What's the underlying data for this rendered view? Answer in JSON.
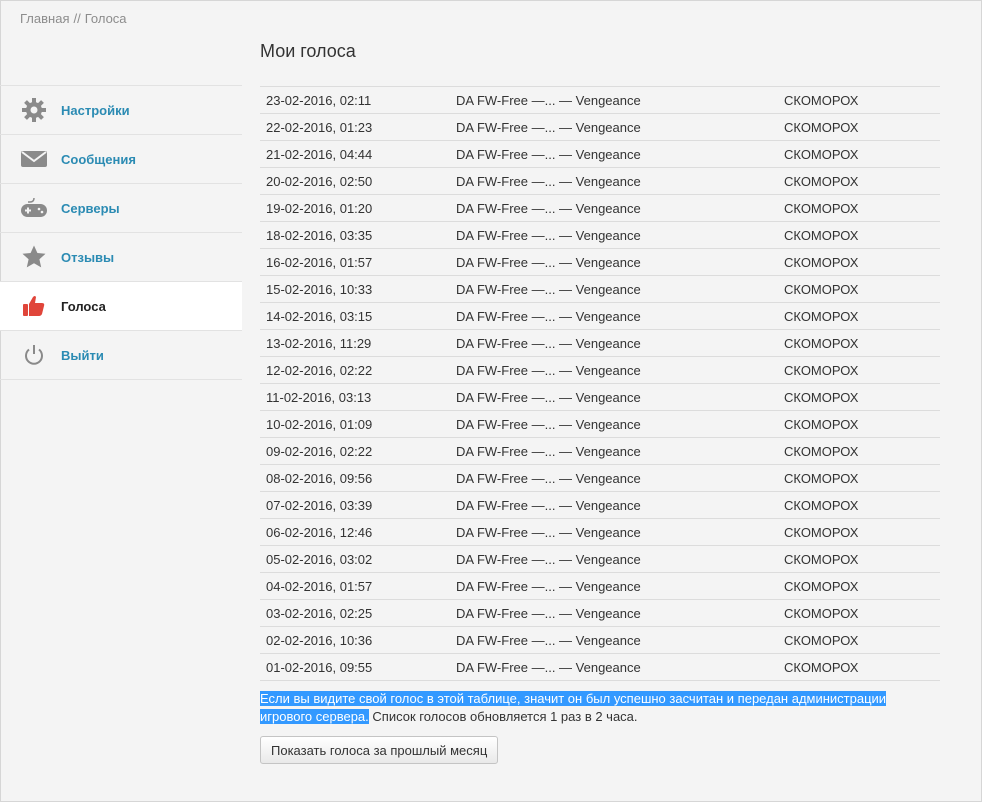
{
  "breadcrumb": {
    "home": "Главная",
    "separator": "//",
    "current": "Голоса"
  },
  "page_title": "Мои голоса",
  "sidebar": {
    "items": [
      {
        "label": "Настройки",
        "icon": "gear-icon"
      },
      {
        "label": "Сообщения",
        "icon": "envelope-icon"
      },
      {
        "label": "Серверы",
        "icon": "gamepad-icon"
      },
      {
        "label": "Отзывы",
        "icon": "star-icon"
      },
      {
        "label": "Голоса",
        "icon": "thumbs-up-icon",
        "active": true
      },
      {
        "label": "Выйти",
        "icon": "power-icon"
      }
    ]
  },
  "votes": [
    {
      "date": "23-02-2016, 02:11",
      "server": "DA FW-Free —... — Vengeance",
      "user": "СКОМОРОХ"
    },
    {
      "date": "22-02-2016, 01:23",
      "server": "DA FW-Free —... — Vengeance",
      "user": "СКОМОРОХ"
    },
    {
      "date": "21-02-2016, 04:44",
      "server": "DA FW-Free —... — Vengeance",
      "user": "СКОМОРОХ"
    },
    {
      "date": "20-02-2016, 02:50",
      "server": "DA FW-Free —... — Vengeance",
      "user": "СКОМОРОХ"
    },
    {
      "date": "19-02-2016, 01:20",
      "server": "DA FW-Free —... — Vengeance",
      "user": "СКОМОРОХ"
    },
    {
      "date": "18-02-2016, 03:35",
      "server": "DA FW-Free —... — Vengeance",
      "user": "СКОМОРОХ"
    },
    {
      "date": "16-02-2016, 01:57",
      "server": "DA FW-Free —... — Vengeance",
      "user": "СКОМОРОХ"
    },
    {
      "date": "15-02-2016, 10:33",
      "server": "DA FW-Free —... — Vengeance",
      "user": "СКОМОРОХ"
    },
    {
      "date": "14-02-2016, 03:15",
      "server": "DA FW-Free —... — Vengeance",
      "user": "СКОМОРОХ"
    },
    {
      "date": "13-02-2016, 11:29",
      "server": "DA FW-Free —... — Vengeance",
      "user": "СКОМОРОХ"
    },
    {
      "date": "12-02-2016, 02:22",
      "server": "DA FW-Free —... — Vengeance",
      "user": "СКОМОРОХ"
    },
    {
      "date": "11-02-2016, 03:13",
      "server": "DA FW-Free —... — Vengeance",
      "user": "СКОМОРОХ"
    },
    {
      "date": "10-02-2016, 01:09",
      "server": "DA FW-Free —... — Vengeance",
      "user": "СКОМОРОХ"
    },
    {
      "date": "09-02-2016, 02:22",
      "server": "DA FW-Free —... — Vengeance",
      "user": "СКОМОРОХ"
    },
    {
      "date": "08-02-2016, 09:56",
      "server": "DA FW-Free —... — Vengeance",
      "user": "СКОМОРОХ"
    },
    {
      "date": "07-02-2016, 03:39",
      "server": "DA FW-Free —... — Vengeance",
      "user": "СКОМОРОХ"
    },
    {
      "date": "06-02-2016, 12:46",
      "server": "DA FW-Free —... — Vengeance",
      "user": "СКОМОРОХ"
    },
    {
      "date": "05-02-2016, 03:02",
      "server": "DA FW-Free —... — Vengeance",
      "user": "СКОМОРОХ"
    },
    {
      "date": "04-02-2016, 01:57",
      "server": "DA FW-Free —... — Vengeance",
      "user": "СКОМОРОХ"
    },
    {
      "date": "03-02-2016, 02:25",
      "server": "DA FW-Free —... — Vengeance",
      "user": "СКОМОРОХ"
    },
    {
      "date": "02-02-2016, 10:36",
      "server": "DA FW-Free —... — Vengeance",
      "user": "СКОМОРОХ"
    },
    {
      "date": "01-02-2016, 09:55",
      "server": "DA FW-Free —... — Vengeance",
      "user": "СКОМОРОХ"
    }
  ],
  "note": {
    "highlighted": "Если вы видите свой голос в этой таблице, значит он был успешно засчитан и передан администрации игрового сервера.",
    "rest": " Список голосов обновляется 1 раз в 2 часа."
  },
  "button_prev_month": "Показать голоса за прошлый месяц",
  "colors": {
    "link": "#2b8bb3",
    "highlight": "#3399ff",
    "thumb": "#e0453a"
  }
}
